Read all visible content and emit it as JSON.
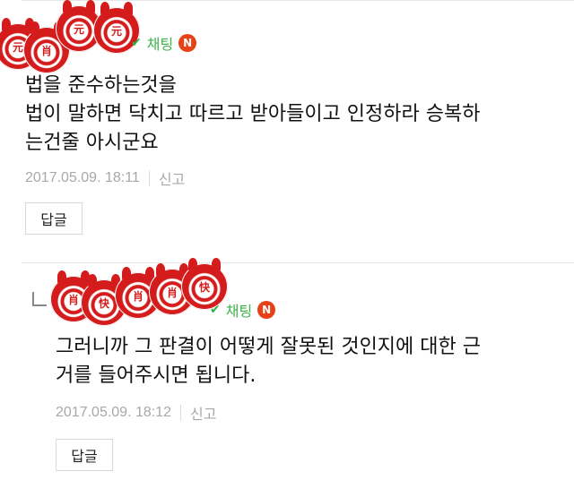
{
  "comments": [
    {
      "author_icon_label": "sticker-avatar-cluster",
      "chat_label": "채팅",
      "badge": "N",
      "lines": [
        "법을 준수하는것을",
        "법이 말하면 닥치고 따르고 받아들이고 인정하라 승복하",
        "는건줄 아시군요"
      ],
      "date": "2017.05.09. 18:11",
      "report": "신고",
      "reply_button": "답글"
    },
    {
      "author_icon_label": "sticker-avatar-cluster",
      "chat_label": "채팅",
      "badge": "N",
      "lines": [
        "그러니까 그 판결이 어떻게 잘못된 것인지에 대한 근",
        "거를 들어주시면 됩니다."
      ],
      "date": "2017.05.09. 18:12",
      "report": "신고",
      "reply_button": "답글"
    }
  ],
  "colors": {
    "green": "#3db54a",
    "badge_red": "#e84118",
    "meta_gray": "#a8a8a8",
    "sticker_red": "#d41c1c"
  },
  "stickers": {
    "c1": [
      "元",
      "肖",
      "元"
    ],
    "c2": [
      "肖",
      "快",
      "肖",
      "肖",
      "快"
    ]
  }
}
